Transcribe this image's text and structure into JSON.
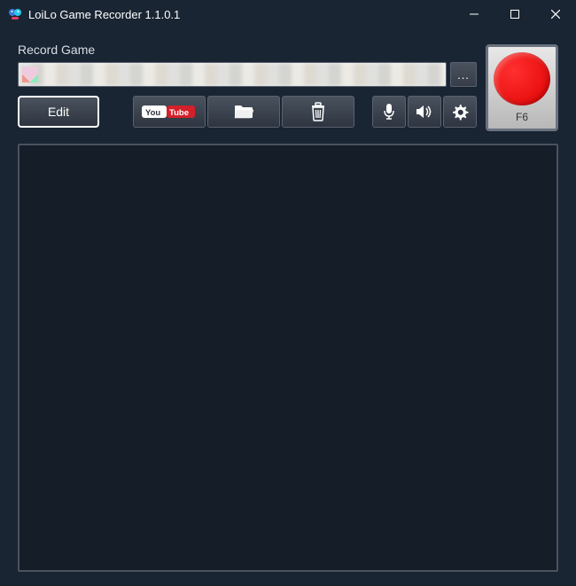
{
  "window": {
    "title": "LoiLo Game Recorder 1.1.0.1"
  },
  "labels": {
    "record_game": "Record Game"
  },
  "toolbar": {
    "edit_label": "Edit",
    "browse_label": "...",
    "youtube_logo_text": "YouTube"
  },
  "record": {
    "hotkey": "F6"
  }
}
